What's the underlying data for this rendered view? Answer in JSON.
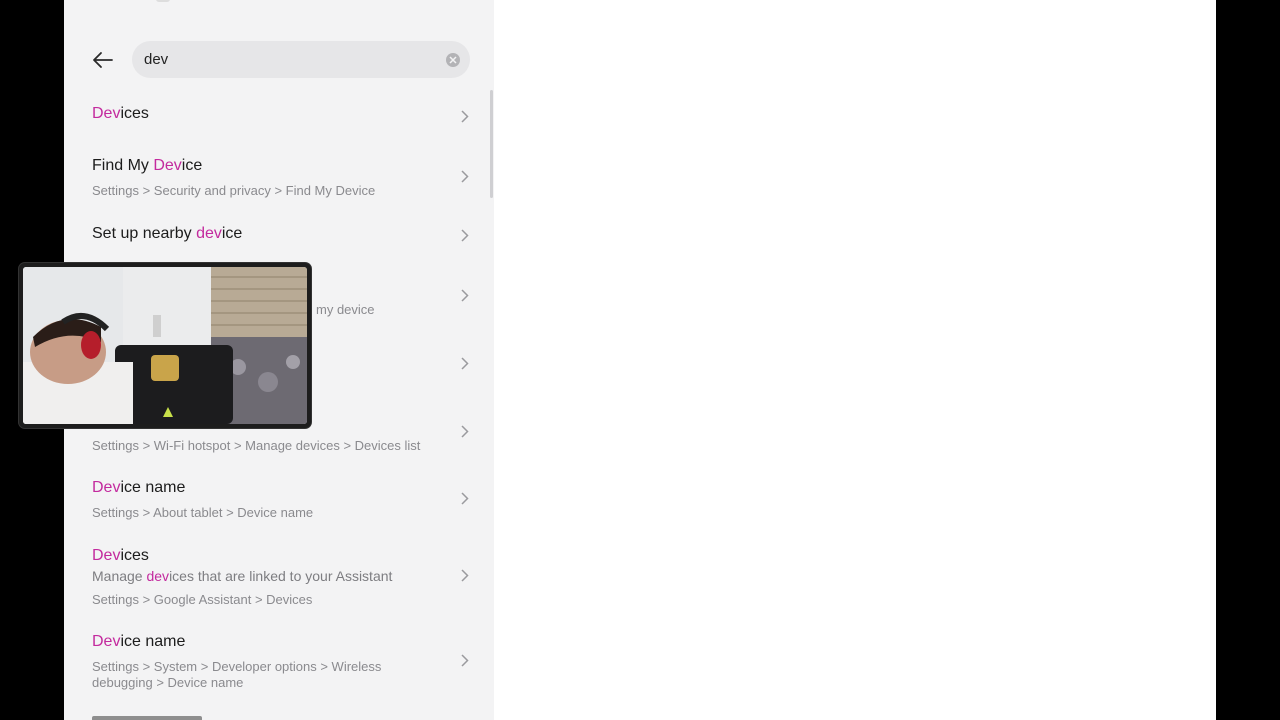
{
  "search": {
    "query": "dev"
  },
  "results": [
    {
      "title_pre": "",
      "title_hl": "Dev",
      "title_post": "ices",
      "path": ""
    },
    {
      "title_pre": "Find My ",
      "title_hl": "Dev",
      "title_post": "ice",
      "path": "Settings > Security and privacy > Find My Device"
    },
    {
      "title_pre": "Set up nearby ",
      "title_hl": "dev",
      "title_post": "ice",
      "path": ""
    },
    {
      "title_pre": "",
      "title_hl": "",
      "title_post": "",
      "path_partial": "my device"
    },
    {
      "title_pre": "",
      "title_hl": "",
      "title_post": "",
      "path": ""
    },
    {
      "title_pre": "",
      "title_hl": "",
      "title_post": "",
      "path": "Settings > Wi-Fi hotspot > Manage devices > Devices list"
    },
    {
      "title_pre": "",
      "title_hl": "Dev",
      "title_post": "ice name",
      "path": "Settings > About tablet > Device name"
    },
    {
      "title_pre": "",
      "title_hl": "Dev",
      "title_post": "ices",
      "desc_pre": "Manage ",
      "desc_hl": "dev",
      "desc_post": "ices that are linked to your Assistant",
      "path": "Settings > Google Assistant > Devices"
    },
    {
      "title_pre": "",
      "title_hl": "Dev",
      "title_post": "ice name",
      "path_line1": "Settings > System > Developer options > Wireless",
      "path_line2": "debugging > Device name"
    }
  ],
  "colors": {
    "highlight": "#c32a9e",
    "panel_bg": "#f3f3f4",
    "detail_bg": "#ffffff"
  },
  "icons": {
    "back": "arrow-left-icon",
    "clear": "clear-x-icon",
    "chevron": "chevron-right-icon"
  }
}
